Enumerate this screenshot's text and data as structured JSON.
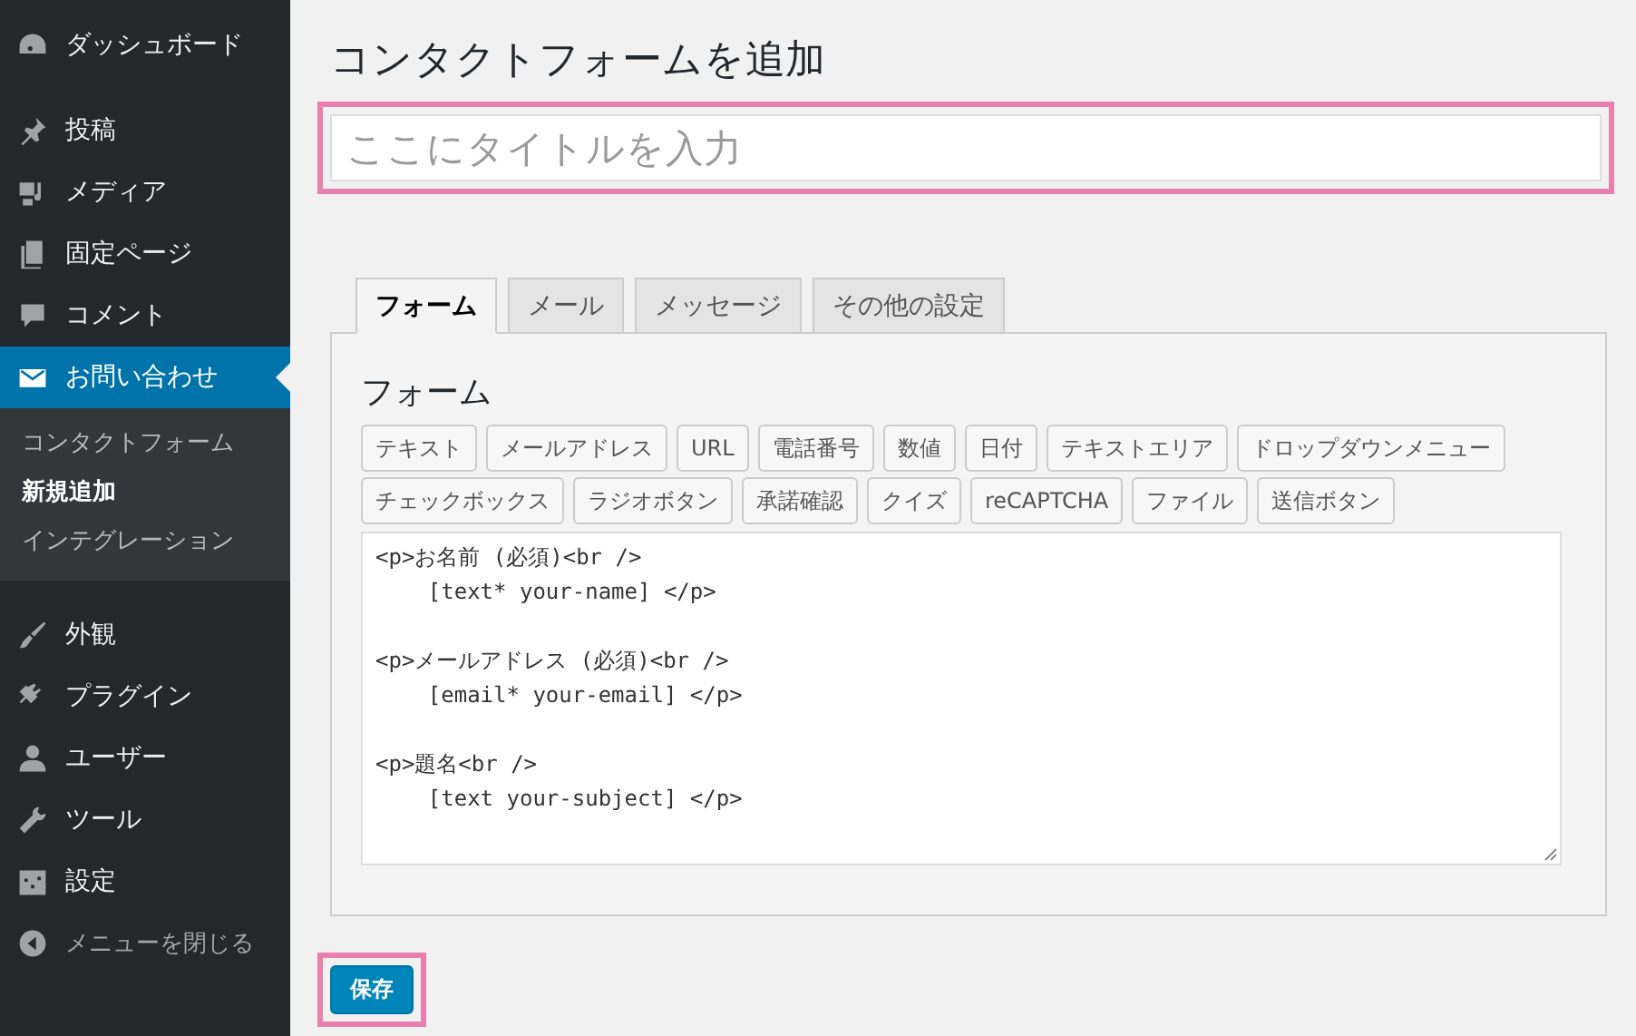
{
  "sidebar": {
    "groups": [
      {
        "items": [
          {
            "label": "ダッシュボード",
            "selected": false
          }
        ]
      },
      {
        "items": [
          {
            "label": "投稿",
            "selected": false
          },
          {
            "label": "メディア",
            "selected": false
          },
          {
            "label": "固定ページ",
            "selected": false
          },
          {
            "label": "コメント",
            "selected": false
          },
          {
            "label": "お問い合わせ",
            "selected": true,
            "children": [
              {
                "label": "コンタクトフォーム",
                "selected": false
              },
              {
                "label": "新規追加",
                "selected": true
              },
              {
                "label": "インテグレーション",
                "selected": false
              }
            ]
          }
        ]
      },
      {
        "items": [
          {
            "label": "外観",
            "selected": false
          },
          {
            "label": "プラグイン",
            "selected": false
          },
          {
            "label": "ユーザー",
            "selected": false
          },
          {
            "label": "ツール",
            "selected": false
          },
          {
            "label": "設定",
            "selected": false
          }
        ]
      }
    ],
    "collapse": "メニューを閉じる"
  },
  "page_title": "コンタクトフォームを追加",
  "title_field": {
    "placeholder": "ここにタイトルを入力",
    "highlighted": true
  },
  "tabs": [
    {
      "label": "フォーム",
      "selected": true
    },
    {
      "label": "メール",
      "selected": false
    },
    {
      "label": "メッセージ",
      "selected": false
    },
    {
      "label": "その他の設定",
      "selected": false
    }
  ],
  "panel": {
    "heading": "フォーム",
    "tag_buttons": [
      "テキスト",
      "メールアドレス",
      "URL",
      "電話番号",
      "数値",
      "日付",
      "テキストエリア",
      "ドロップダウンメニュー",
      "チェックボックス",
      "ラジオボタン",
      "承諾確認",
      "クイズ",
      "reCAPTCHA",
      "ファイル",
      "送信ボタン"
    ],
    "editor": "<p>お名前 (必須)<br />\n    [text* your-name] </p>\n\n<p>メールアドレス (必須)<br />\n    [email* your-email] </p>\n\n<p>題名<br />\n    [text your-subject] </p>"
  },
  "save_button": {
    "label": "保存",
    "highlighted": true
  }
}
